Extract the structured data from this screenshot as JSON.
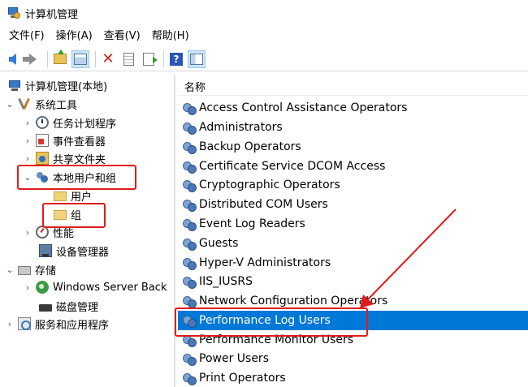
{
  "window": {
    "title": "计算机管理"
  },
  "menu": [
    "文件(F)",
    "操作(A)",
    "查看(V)",
    "帮助(H)"
  ],
  "toolbar": {
    "icons": [
      "back-arrow-icon",
      "forward-arrow-icon",
      "up-folder-icon",
      "show-hide-tree-icon",
      "delete-icon",
      "properties-icon",
      "export-list-icon",
      "help-icon",
      "show-hide-action-pane-icon"
    ],
    "help_glyph": "?",
    "delete_glyph": "✕"
  },
  "tree": {
    "expand_glyph": "›",
    "collapse_glyph": "⌄",
    "items": [
      {
        "label": "计算机管理(本地)",
        "icon": "computer-icon"
      },
      {
        "label": "系统工具",
        "icon": "tools-icon"
      },
      {
        "label": "任务计划程序",
        "icon": "clock-icon"
      },
      {
        "label": "事件查看器",
        "icon": "event-viewer-icon"
      },
      {
        "label": "共享文件夹",
        "icon": "shared-folder-icon"
      },
      {
        "label": "本地用户和组",
        "icon": "users-icon"
      },
      {
        "label": "用户",
        "icon": "folder-icon"
      },
      {
        "label": "组",
        "icon": "folder-icon"
      },
      {
        "label": "性能",
        "icon": "performance-icon"
      },
      {
        "label": "设备管理器",
        "icon": "device-manager-icon"
      },
      {
        "label": "存储",
        "icon": "storage-icon"
      },
      {
        "label": "Windows Server Back",
        "icon": "backup-icon"
      },
      {
        "label": "磁盘管理",
        "icon": "disk-icon"
      },
      {
        "label": "服务和应用程序",
        "icon": "services-icon"
      }
    ]
  },
  "list": {
    "column_header": "名称",
    "selected": "Performance Log Users",
    "items": [
      "Access Control Assistance Operators",
      "Administrators",
      "Backup Operators",
      "Certificate Service DCOM Access",
      "Cryptographic Operators",
      "Distributed COM Users",
      "Event Log Readers",
      "Guests",
      "Hyper-V Administrators",
      "IIS_IUSRS",
      "Network Configuration Operators",
      "Performance Log Users",
      "Performance Monitor Users",
      "Power Users",
      "Print Operators"
    ]
  },
  "colors": {
    "selection": "#0078d7",
    "annotation": "#e11b1b"
  }
}
